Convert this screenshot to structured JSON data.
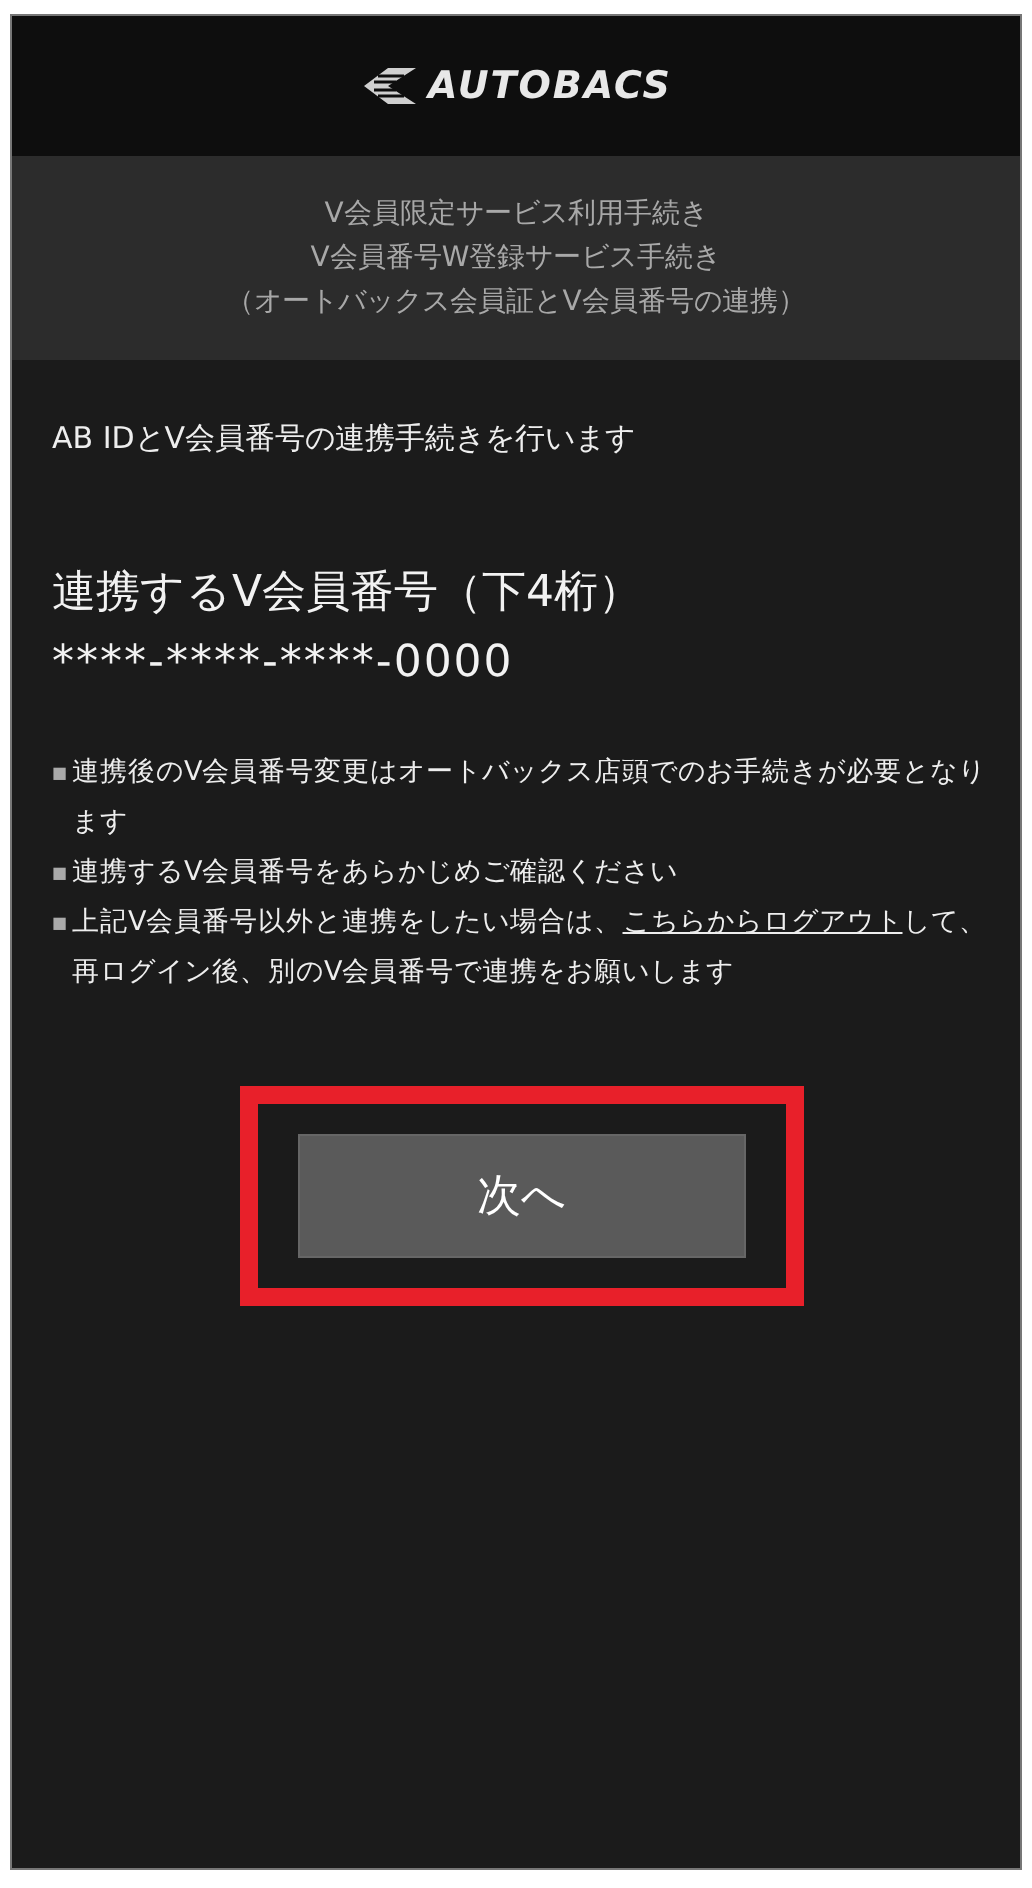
{
  "header": {
    "logo": "AUTOBACS"
  },
  "banner": {
    "lines": [
      "V会員限定サービス利用手続き",
      "V会員番号W登録サービス手続き",
      "（オートバックス会員証とV会員番号の連携）"
    ]
  },
  "intro": "AB IDとV会員番号の連携手続きを行います",
  "member_number": {
    "label": "連携するV会員番号（下4桁）",
    "value": "****-****-****-0000"
  },
  "notes": [
    {
      "bullet": "■",
      "text": "連携後のV会員番号変更はオートバックス店頭でのお手続きが必要となります"
    },
    {
      "bullet": "■",
      "text": "連携するV会員番号をあらかじめご確認ください"
    },
    {
      "bullet": "■",
      "text": "上記V会員番号以外と連携をしたい場合は、",
      "link": "こちらからログアウト",
      "text_after": "して、再ログイン後、別のV会員番号で連携をお願いします"
    }
  ],
  "next_button": {
    "label": "次へ",
    "highlighted": true
  }
}
